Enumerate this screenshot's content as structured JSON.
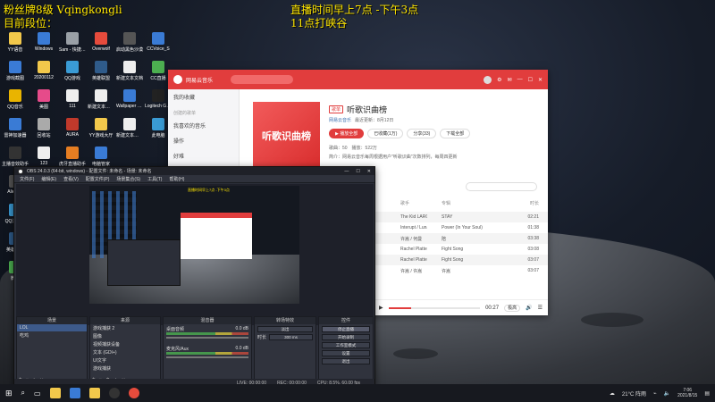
{
  "overlay": {
    "line1": "粉丝牌8级 Vqingkongli",
    "line2": "目前段位：",
    "schedule1": "直播时间早上7点 -下午3点",
    "schedule2": "11点打峡谷"
  },
  "desktop_icons": [
    {
      "label": "YY语音",
      "color": "#f2c84b"
    },
    {
      "label": "Windows",
      "color": "#3a7bd5"
    },
    {
      "label": "Sam - 快捷方式",
      "color": "#9aa0a6"
    },
    {
      "label": "Overwolf",
      "color": "#e64b3c"
    },
    {
      "label": "启动黑色沙漠",
      "color": "#555"
    },
    {
      "label": "CCVoice_S",
      "color": "#3a7bd5"
    },
    {
      "label": "游戏截图",
      "color": "#3a7bd5"
    },
    {
      "label": "20200112",
      "color": "#f2c84b"
    },
    {
      "label": "QQ游戏",
      "color": "#3a9bd5"
    },
    {
      "label": "英雄联盟",
      "color": "#2f5b8a"
    },
    {
      "label": "新建文本文档",
      "color": "#eee"
    },
    {
      "label": "CC直播",
      "color": "#4caf50"
    },
    {
      "label": "QQ音乐",
      "color": "#e9b400"
    },
    {
      "label": "美图",
      "color": "#e64b8a"
    },
    {
      "label": "111",
      "color": "#eee"
    },
    {
      "label": "新建文本文档 (2)",
      "color": "#eee"
    },
    {
      "label": "Wallpaper Engine",
      "color": "#3a7bd5"
    },
    {
      "label": "Logitech G HUB",
      "color": "#222"
    },
    {
      "label": "雷神加速器",
      "color": "#3a7bd5"
    },
    {
      "label": "回收站",
      "color": "#aaa"
    },
    {
      "label": "AURA",
      "color": "#c0392b"
    },
    {
      "label": "YY游戏大厅",
      "color": "#f2c84b"
    },
    {
      "label": "新建文本文档 (3)",
      "color": "#eee"
    },
    {
      "label": "此电脑",
      "color": "#3a9bd5"
    },
    {
      "label": "主播音效助手",
      "color": "#333"
    },
    {
      "label": "123",
      "color": "#eee"
    },
    {
      "label": "虎牙直播助手",
      "color": "#e67e22"
    },
    {
      "label": "电脑管家",
      "color": "#3a7bd5"
    },
    {
      "label": "AlienFX",
      "color": "#555"
    },
    {
      "label": "QQ浏览器",
      "color": "#3a9bd5"
    },
    {
      "label": "英雄联盟",
      "color": "#2f5b8a"
    },
    {
      "label": "微信",
      "color": "#4caf50"
    }
  ],
  "music": {
    "app_name": "网易云音乐",
    "sidebar": {
      "items": [
        "我的收藏",
        "我喜欢的音乐",
        "操作",
        "好难"
      ],
      "section": "创建的歌单"
    },
    "playlist": {
      "tag": "歌单",
      "title": "听歌识曲榜",
      "cover_text": "听歌识曲榜",
      "creator": "网易云音乐",
      "updated": "最近更新：8月12日",
      "play_all": "播放全部",
      "collect": "已收藏(1万)",
      "share": "分享(33)",
      "download": "下载全部",
      "stats": "歌曲：50　播放：522万",
      "desc": "简介：网易云音乐每周根据用户\"听歌识曲\"次数排列，每周四更新"
    },
    "table": {
      "headers": [
        "歌手",
        "专辑",
        "时长"
      ],
      "rows": [
        [
          "The Kid LAROI / Ju",
          "STAY",
          "02:21"
        ],
        [
          "Interupt / Luna LeP",
          "Power (In Your Soul)",
          "01:38"
        ],
        [
          "许嵩 / 何曼",
          "陪",
          "03:38"
        ],
        [
          "Rachel Platten",
          "Fight Song",
          "03:08"
        ],
        [
          "Rachel Platten",
          "Fight Song",
          "03:07"
        ],
        [
          "许嵩 / 许嵩",
          "许嵩",
          "03:07"
        ]
      ]
    },
    "player": {
      "time": "00:27",
      "quality": "极高",
      "playlist_label": "打开播放页"
    }
  },
  "obs": {
    "title": "OBS 24.0.3 (64-bit, windows) - 配置文件: 未命名 - 场景: 未命名",
    "menu": [
      "文件(F)",
      "编辑(E)",
      "查看(V)",
      "配置文件(P)",
      "场景集合(S)",
      "工具(T)",
      "帮助(H)"
    ],
    "docks": {
      "scenes": {
        "header": "场景",
        "items": [
          "LOL",
          "吃鸡"
        ]
      },
      "sources": {
        "header": "来源",
        "items": [
          "游戏捕获 2",
          "图像",
          "视频捕获设备",
          "文本 (GDI+)",
          "UI文字",
          "游戏捕获"
        ]
      },
      "mixer": {
        "header": "混音器",
        "channels": [
          {
            "name": "桌面音频",
            "db": "0.0 dB"
          },
          {
            "name": "麦克风/Aux",
            "db": "0.0 dB"
          }
        ]
      },
      "transition": {
        "header": "转场特效",
        "mode": "淡出",
        "duration_label": "时长",
        "duration": "300 ms"
      },
      "controls": {
        "header": "控件",
        "buttons": [
          "停止直播",
          "开始录制",
          "工作室模式",
          "设置",
          "退出"
        ]
      }
    },
    "status": [
      "LIVE: 00:00:00",
      "REC: 00:00:00",
      "CPU: 8.5%, 60.00 fps"
    ]
  },
  "taskbar": {
    "weather": "21°C 阵雨",
    "time": "7:06",
    "date": "2021/8/15"
  }
}
